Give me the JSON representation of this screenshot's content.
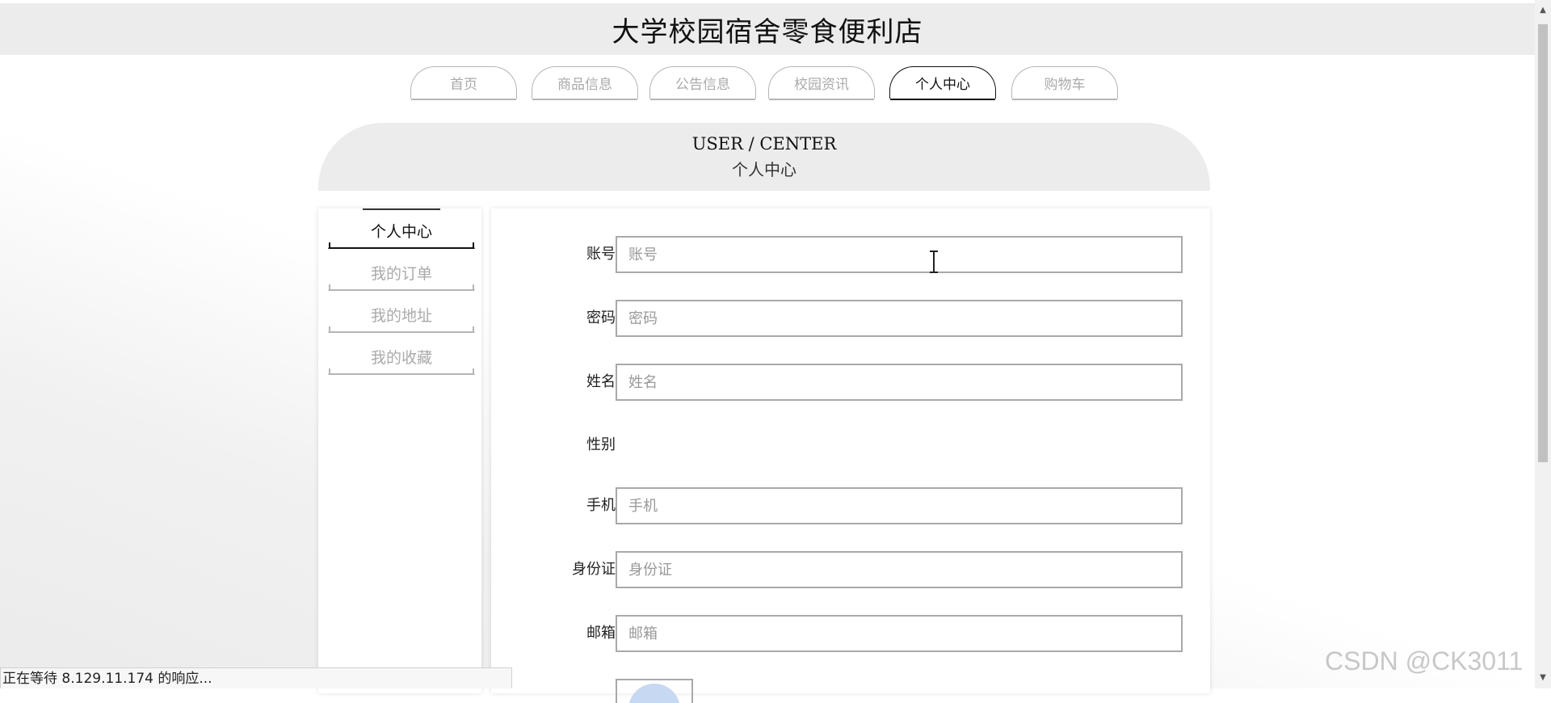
{
  "site": {
    "title": "大学校园宿舍零食便利店"
  },
  "nav": {
    "items": [
      {
        "label": "首页",
        "active": false
      },
      {
        "label": "商品信息",
        "active": false
      },
      {
        "label": "公告信息",
        "active": false
      },
      {
        "label": "校园资讯",
        "active": false
      },
      {
        "label": "个人中心",
        "active": true
      },
      {
        "label": "购物车",
        "active": false
      }
    ]
  },
  "banner": {
    "en": "USER / CENTER",
    "cn": "个人中心"
  },
  "sidebar": {
    "items": [
      {
        "label": "个人中心",
        "active": true
      },
      {
        "label": "我的订单",
        "active": false
      },
      {
        "label": "我的地址",
        "active": false
      },
      {
        "label": "我的收藏",
        "active": false
      }
    ]
  },
  "form": {
    "account": {
      "label": "账号",
      "placeholder": "账号"
    },
    "password": {
      "label": "密码",
      "placeholder": "密码"
    },
    "name": {
      "label": "姓名",
      "placeholder": "姓名"
    },
    "gender": {
      "label": "性别"
    },
    "phone": {
      "label": "手机",
      "placeholder": "手机"
    },
    "id_card": {
      "label": "身份证",
      "placeholder": "身份证"
    },
    "email": {
      "label": "邮箱",
      "placeholder": "邮箱"
    }
  },
  "status": {
    "text": "正在等待 8.129.11.174 的响应..."
  },
  "watermark": {
    "text": "CSDN @CK3011"
  },
  "colors": {
    "active": "#111111",
    "inactive": "#aaaaaa",
    "panel_bg": "#ececec"
  }
}
